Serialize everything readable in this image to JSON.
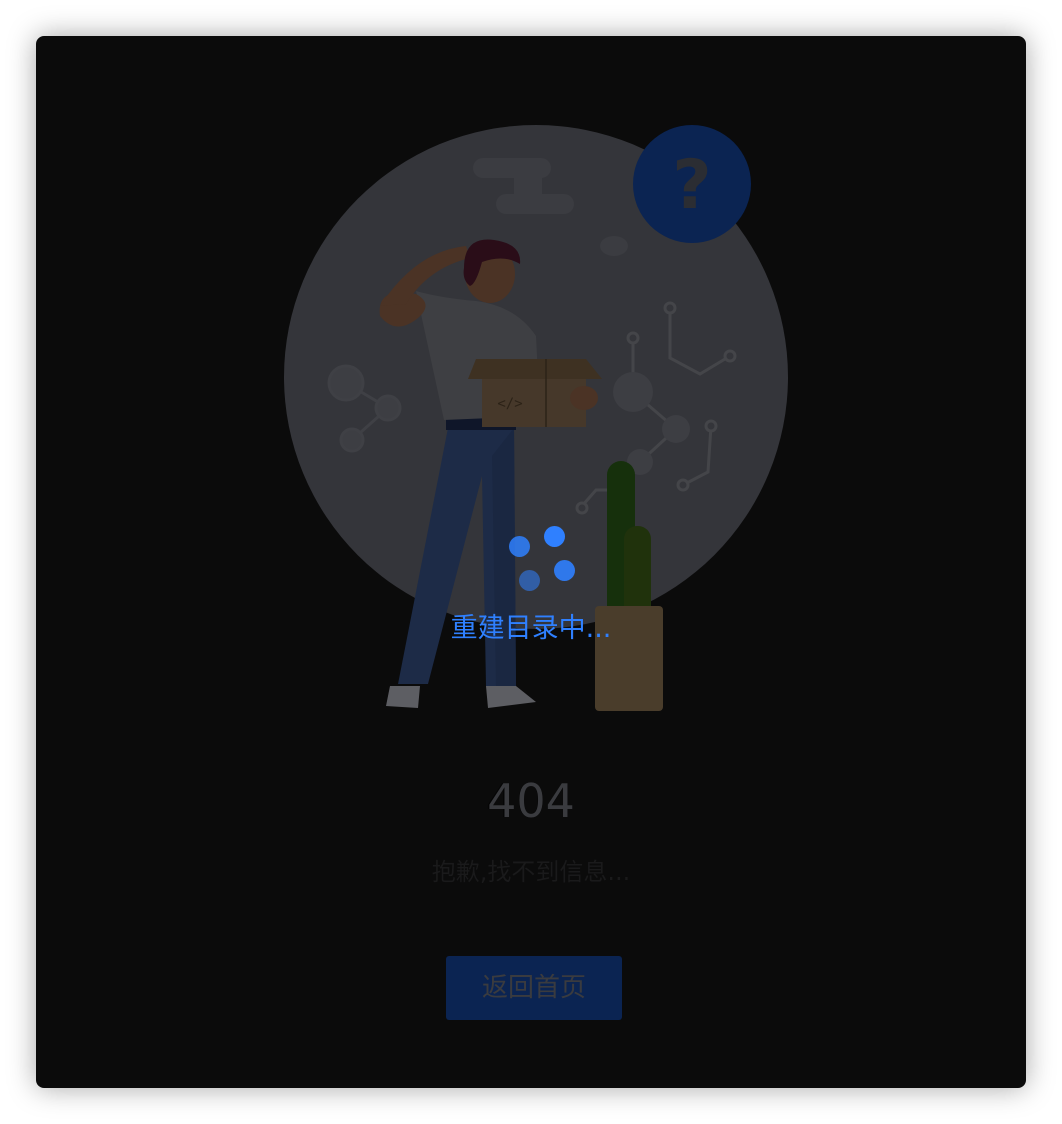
{
  "error": {
    "code": "404",
    "message": "抱歉,找不到信息..."
  },
  "actions": {
    "home_label": "返回首页"
  },
  "loading": {
    "text": "重建目录中..."
  },
  "illustration": {
    "question_mark": "?",
    "box_glyph": "</>"
  },
  "colors": {
    "accent": "#2f80ff",
    "button_bg": "#1e61ea"
  }
}
